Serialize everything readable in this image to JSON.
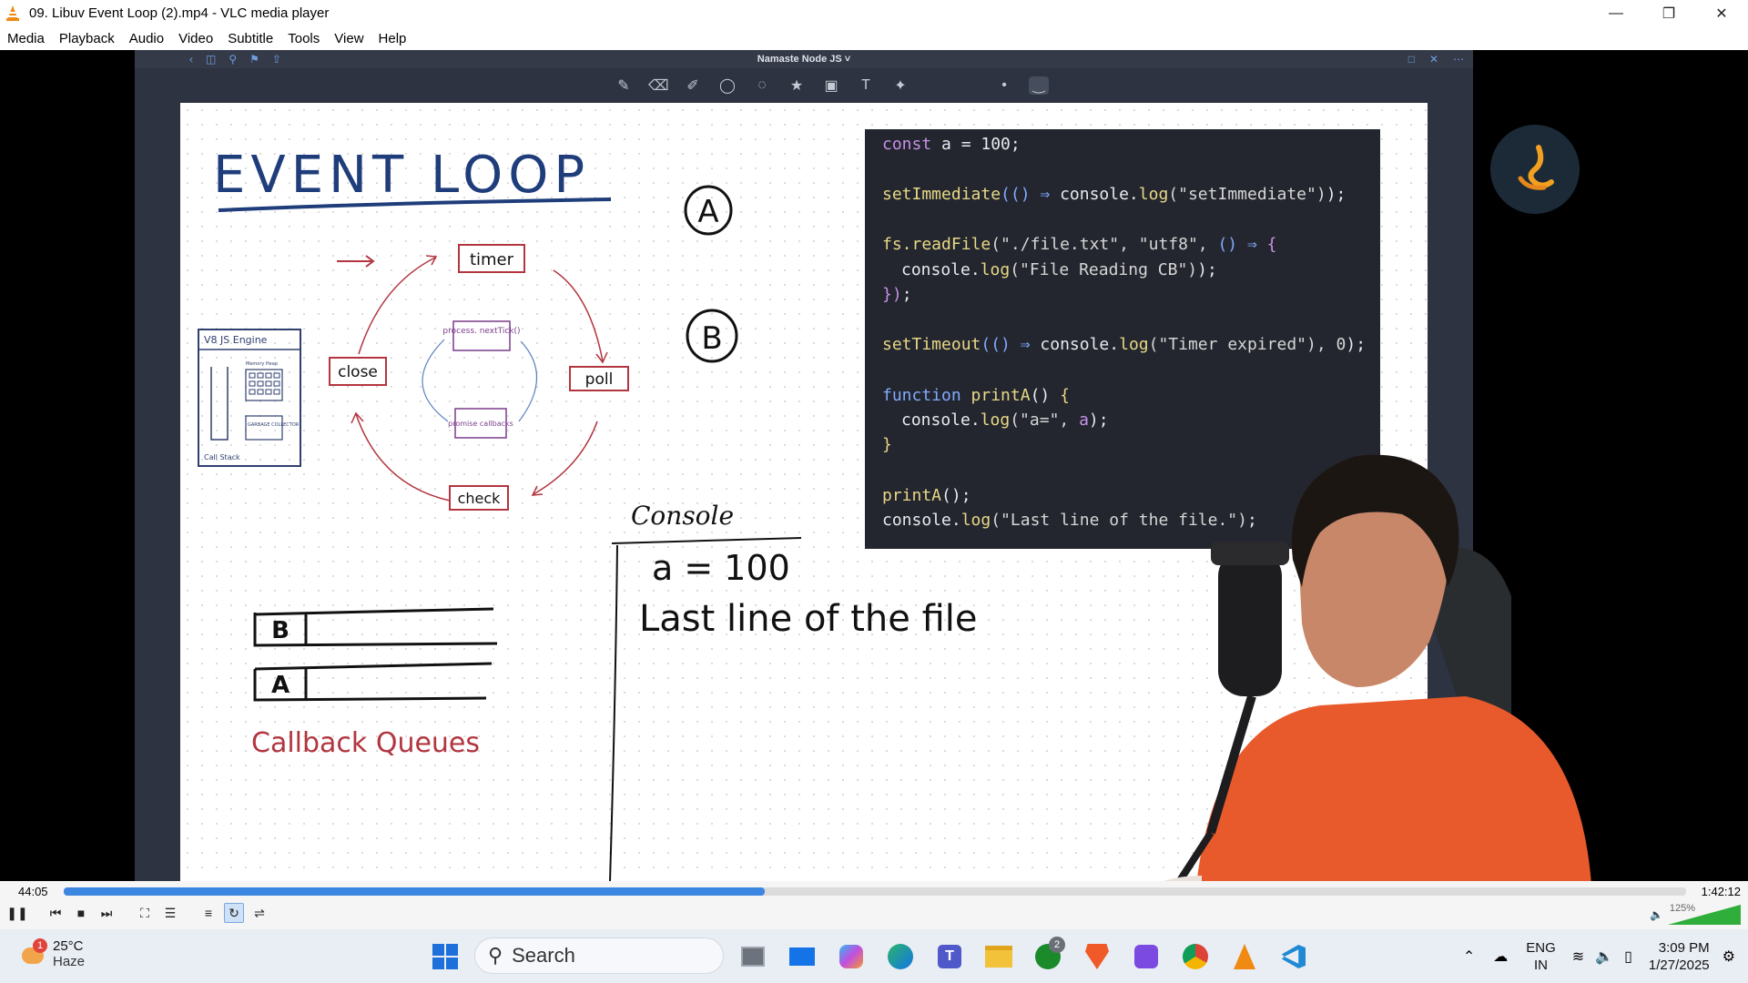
{
  "window": {
    "title": "09. Libuv  Event Loop (2).mp4 - VLC media player",
    "controls": [
      "minimize-icon",
      "maximize-icon",
      "close-icon"
    ]
  },
  "menu": [
    "Media",
    "Playback",
    "Audio",
    "Video",
    "Subtitle",
    "Tools",
    "View",
    "Help"
  ],
  "video": {
    "app_title": "Namaste Node JS ˅",
    "whiteboard": {
      "heading": "EVENT LOOP",
      "phases": [
        "timer",
        "poll",
        "check",
        "close"
      ],
      "micro": [
        "process. nextTick()",
        "promise callbacks"
      ],
      "engine_title": "V8 JS Engine",
      "engine_labels": [
        "Memory Heap",
        "GARBAGE COLLECTOR",
        "Call Stack"
      ],
      "markers": [
        "A",
        "B"
      ],
      "queue_labels": [
        "B",
        "A"
      ],
      "queues_caption": "Callback Queues",
      "console_title": "Console",
      "console_lines": [
        "a = 100",
        "Last line of the file"
      ]
    },
    "code": [
      "const a = 100;",
      "setImmediate(() ⇒ console.log(\"setImmediate\"));",
      "fs.readFile(\"./file.txt\", \"utf8\", () ⇒ {",
      "console.log(\"File Reading CB\");",
      "});",
      "setTimeout(() ⇒ console.log(\"Timer expired\"), 0);",
      "function printA() {",
      "console.log(\"a=\", a);",
      "}",
      "printA();",
      "console.log(\"Last line of the file.\");"
    ]
  },
  "player": {
    "time_current": "44:05",
    "time_total": "1:42:12",
    "progress": 0.432,
    "volume_label": "125%",
    "volume_level": 1.25
  },
  "taskbar": {
    "weather_temp": "25°C",
    "weather_cond": "Haze",
    "weather_badge": "1",
    "search_placeholder": "Search",
    "xbox_badge": "2",
    "lang_top": "ENG",
    "lang_bottom": "IN",
    "time": "3:09 PM",
    "date": "1/27/2025"
  }
}
